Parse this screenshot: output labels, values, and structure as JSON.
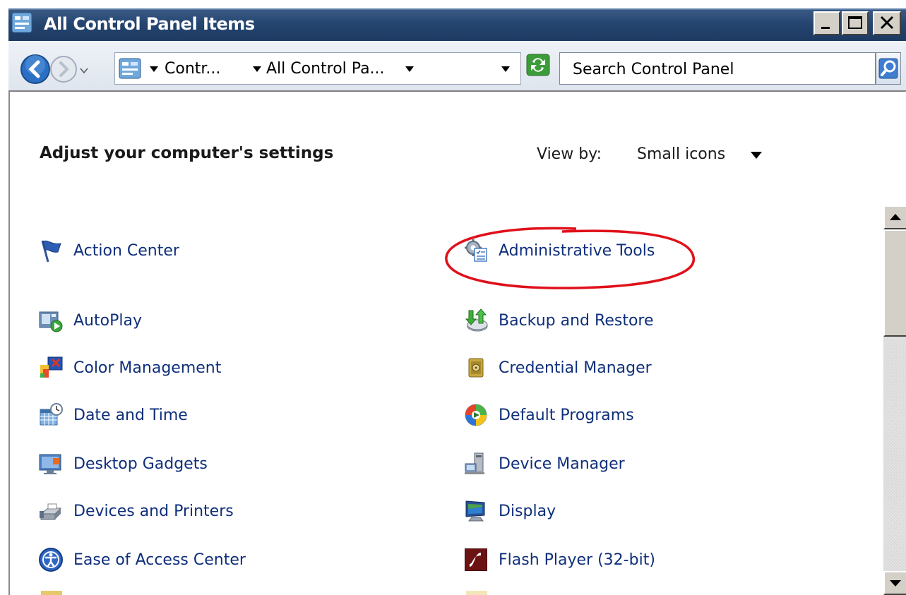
{
  "window": {
    "title": "All Control Panel Items"
  },
  "navigation": {
    "breadcrumb": [
      {
        "label": "Contr..."
      },
      {
        "label": "All Control Pa..."
      }
    ],
    "search_placeholder": "Search Control Panel"
  },
  "content": {
    "heading": "Adjust your computer's settings",
    "view_by_label": "View by:",
    "view_by_value": "Small icons"
  },
  "items": [
    {
      "label": "Action Center",
      "icon": "flag-icon"
    },
    {
      "label": "Administrative Tools",
      "icon": "admin-tools-icon",
      "highlighted": true
    },
    {
      "label": "AutoPlay",
      "icon": "autoplay-icon"
    },
    {
      "label": "Backup and Restore",
      "icon": "backup-icon"
    },
    {
      "label": "Color Management",
      "icon": "color-management-icon"
    },
    {
      "label": "Credential Manager",
      "icon": "credential-vault-icon"
    },
    {
      "label": "Date and Time",
      "icon": "calendar-clock-icon"
    },
    {
      "label": "Default Programs",
      "icon": "default-programs-icon"
    },
    {
      "label": "Desktop Gadgets",
      "icon": "desktop-gadgets-icon"
    },
    {
      "label": "Device Manager",
      "icon": "device-manager-icon"
    },
    {
      "label": "Devices and Printers",
      "icon": "printer-icon"
    },
    {
      "label": "Display",
      "icon": "display-monitor-icon"
    },
    {
      "label": "Ease of Access Center",
      "icon": "ease-of-access-icon"
    },
    {
      "label": "Flash Player (32-bit)",
      "icon": "flash-player-icon"
    }
  ],
  "colors": {
    "link_text": "#0f2f7a",
    "title_bar": "#24456f",
    "highlight_ellipse": "#e0101a"
  }
}
